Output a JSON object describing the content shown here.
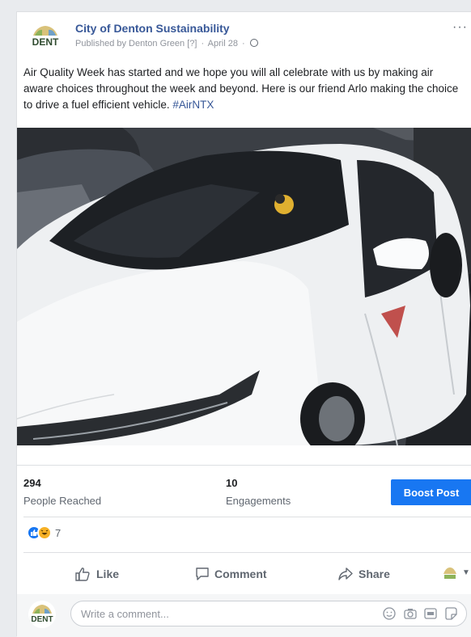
{
  "post": {
    "page_name": "City of Denton Sustainability",
    "published_by": "Published by Denton Green",
    "info_marker": "[?]",
    "date": "April 28",
    "text": "Air Quality Week has started and we hope you will all celebrate with us by making air aware choices throughout the week and beyond. Here is our friend Arlo making the choice to drive a fuel efficient vehicle.",
    "hashtag": "#AirNTX",
    "avatar_text": "DENT"
  },
  "stats": {
    "reached_count": "294",
    "reached_label": "People Reached",
    "engagements_count": "10",
    "engagements_label": "Engagements",
    "boost_label": "Boost Post"
  },
  "reactions": {
    "count": "7",
    "types": [
      "like-icon",
      "haha-icon"
    ]
  },
  "actions": {
    "like": "Like",
    "comment": "Comment",
    "share": "Share"
  },
  "comment": {
    "placeholder": "Write a comment...",
    "icons": [
      "emoji-icon",
      "camera-icon",
      "gif-icon",
      "sticker-icon"
    ]
  },
  "colors": {
    "link_blue": "#385898",
    "boost_blue": "#1877f2",
    "car_white": "#f2f3f4"
  }
}
